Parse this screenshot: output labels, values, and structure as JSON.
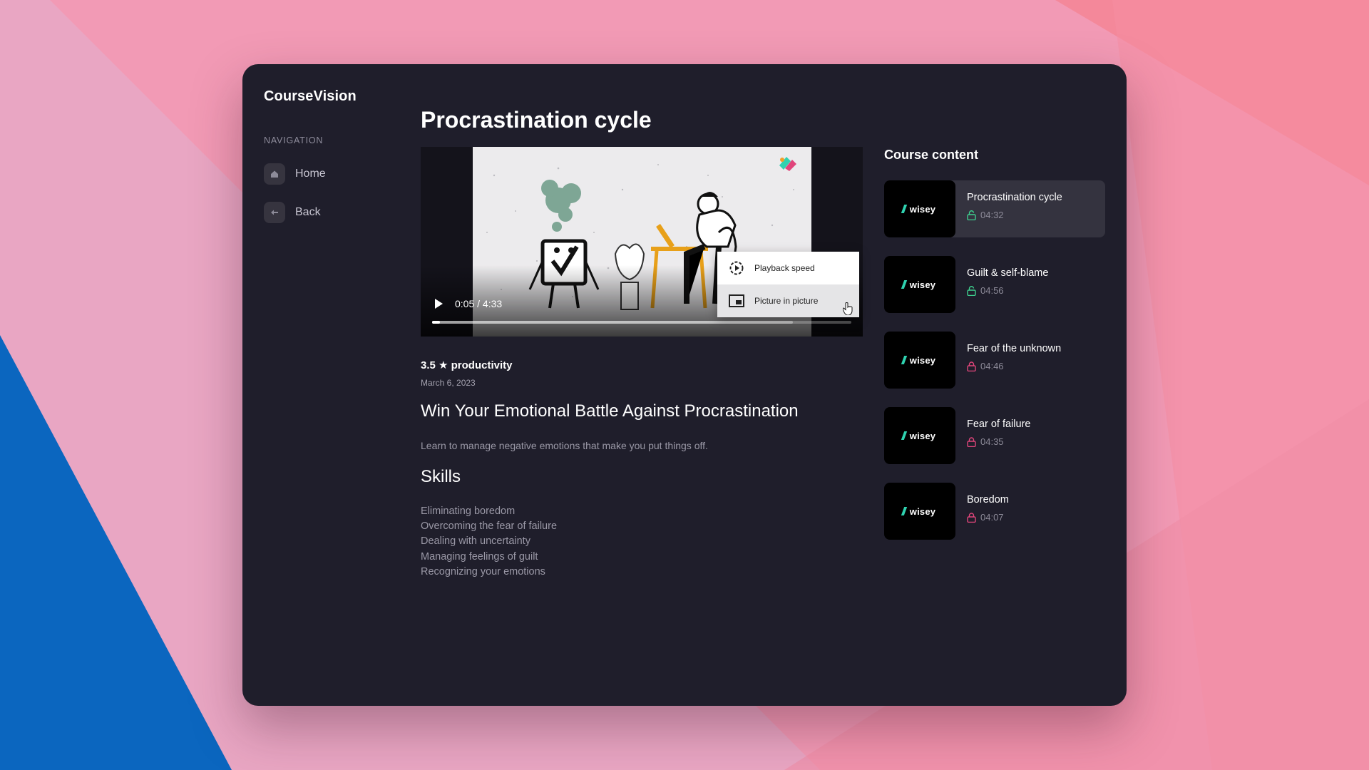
{
  "app": {
    "name": "CourseVision"
  },
  "colors": {
    "accent_unlocked": "#3ecf8e",
    "accent_locked": "#e0457b",
    "window_bg": "#1f1e2b"
  },
  "sidebar": {
    "section_label": "NAVIGATION",
    "items": [
      {
        "label": "Home",
        "icon": "home-icon"
      },
      {
        "label": "Back",
        "icon": "arrow-left-icon"
      }
    ]
  },
  "main": {
    "title": "Procrastination cycle",
    "video": {
      "time": "0:05 / 4:33",
      "progress_fraction": 0.018,
      "buffered_fraction": 0.86,
      "menu": [
        {
          "label": "Playback speed",
          "icon": "playback-speed-icon"
        },
        {
          "label": "Picture in picture",
          "icon": "picture-in-picture-icon"
        }
      ]
    },
    "rating_line": "3.5 ★ productivity",
    "date": "March 6, 2023",
    "course_title": "Win Your Emotional Battle Against Procrastination",
    "description": "Learn to manage negative emotions that make you put things off.",
    "skills_heading": "Skills",
    "skills": [
      "Eliminating boredom",
      "Overcoming the fear of failure",
      "Dealing with uncertainty",
      "Managing feelings of guilt",
      "Recognizing your emotions"
    ]
  },
  "course_content": {
    "heading": "Course content",
    "thumb_logo": "wisey",
    "items": [
      {
        "title": "Procrastination cycle",
        "duration": "04:32",
        "locked": false,
        "active": true
      },
      {
        "title": "Guilt & self-blame",
        "duration": "04:56",
        "locked": false,
        "active": false
      },
      {
        "title": "Fear of the unknown",
        "duration": "04:46",
        "locked": true,
        "active": false
      },
      {
        "title": "Fear of failure",
        "duration": "04:35",
        "locked": true,
        "active": false
      },
      {
        "title": "Boredom",
        "duration": "04:07",
        "locked": true,
        "active": false
      }
    ]
  }
}
